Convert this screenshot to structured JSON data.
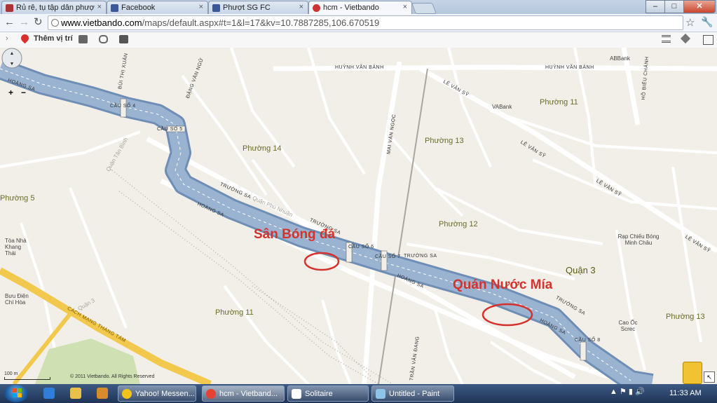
{
  "browser": {
    "tabs": [
      {
        "label": "Rủ rê, tụ tập dân phượ",
        "active": false
      },
      {
        "label": "Facebook",
        "active": false
      },
      {
        "label": "Phượt SG FC",
        "active": false
      },
      {
        "label": "hcm - Vietbando",
        "active": true
      }
    ],
    "url_domain": "www.vietbando.com",
    "url_path": "/maps/default.aspx#t=1&l=17&kv=10.7887285,106.670519",
    "window_buttons": {
      "minimize": "–",
      "maximize": "□",
      "close": "✕"
    }
  },
  "map_toolbar": {
    "add_location_label": "Thêm vị trí"
  },
  "map": {
    "wards": [
      "Phường 14",
      "Phường 13",
      "Phường 11",
      "Phường 12",
      "Phường 5",
      "Phường 11",
      "Phường 13",
      "Quận 3"
    ],
    "roads": [
      "HUỲNH VĂN BÁNH",
      "HUỲNH VĂN BÁNH",
      "LÊ VĂN SỸ",
      "LÊ VĂN SỸ",
      "LÊ VĂN SỸ",
      "LÊ VĂN SỸ",
      "TRƯỜNG SA",
      "TRƯỜNG SA",
      "TRƯỜNG SA",
      "TRƯỜNG SA",
      "HOÀNG SA",
      "HOÀNG SA",
      "HOÀNG SA",
      "HOÀNG SA",
      "CÁCH MẠNG THÁNG TÁM",
      "MAI VĂN NGỌC",
      "TRẦN VĂN ĐANG",
      "BÙI THỊ XUÂN",
      "ĐẶNG VĂN NGỮ",
      "HỒ BIỂU CHÁNH"
    ],
    "bridges": [
      "CẦU SỐ 4",
      "CẦU SỐ 5",
      "CẦU SỐ 6",
      "CẦU SỐ 7",
      "CẦU SỐ 8"
    ],
    "places": [
      "Tòa Nhà Khang Thái",
      "Bưu Điện Chí Hòa",
      "VABank",
      "ABBank",
      "Rạp Chiếu Bóng Minh Châu",
      "Cao Ốc Screc"
    ],
    "district_labels": [
      "Quận Phú Nhuận",
      "Quận Tân Bình",
      "Quận 3"
    ],
    "annotations": [
      {
        "text": "Sân Bóng đá",
        "color": "#d6322d"
      },
      {
        "text": "Quán Nước Mía",
        "color": "#d6322d"
      }
    ],
    "scale_label": "100 m",
    "copyright": "© 2011 Vietbando. All Rights Reserved"
  },
  "taskbar": {
    "items": [
      {
        "label": "Yahoo! Messen...",
        "active": false
      },
      {
        "label": "hcm - Vietband...",
        "active": true
      },
      {
        "label": "Solitaire",
        "active": false
      },
      {
        "label": "Untitled - Paint",
        "active": false
      }
    ],
    "clock": "11:33 AM"
  },
  "colors": {
    "canal": "#8ea8c8",
    "map_bg": "#f2efe9",
    "highway": "#f2c94c",
    "annotation": "#d6322d"
  }
}
